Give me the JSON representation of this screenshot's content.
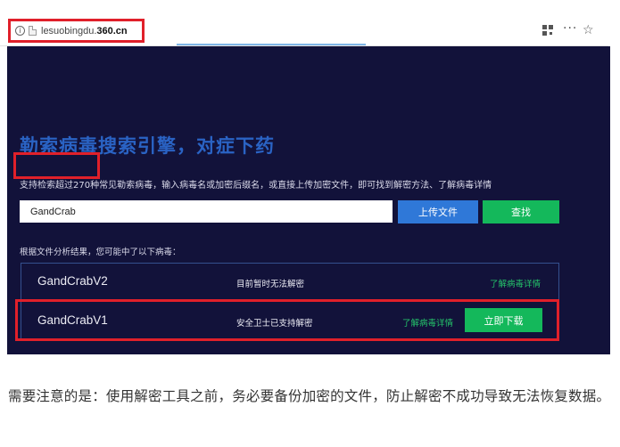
{
  "browser": {
    "url_prefix": "lesuobingdu.",
    "url_domain": "360.cn",
    "icons": {
      "info": "info-icon",
      "page": "page-icon",
      "qr": "qr-code-icon",
      "menu": "more-menu-icon",
      "bookmark": "star-icon"
    }
  },
  "page": {
    "headline": "勒索病毒搜索引擎，对症下药",
    "subtitle": "支持检索超过270种常见勒索病毒，输入病毒名或加密后缀名，或直接上传加密文件，即可找到解密方法、了解病毒详情",
    "search_value": "GandCrab",
    "upload_label": "上传文件",
    "search_label": "查找",
    "result_hint": "根据文件分析结果，您可能中了以下病毒：",
    "results": [
      {
        "name": "GandCrabV2",
        "status": "目前暂时无法解密",
        "details_label": "了解病毒详情"
      },
      {
        "name": "GandCrabV1",
        "status": "安全卫士已支持解密",
        "details_label": "了解病毒详情",
        "download_label": "立即下载"
      }
    ]
  },
  "note": "需要注意的是：使用解密工具之前，务必要备份加密的文件，防止解密不成功导致无法恢复数据。",
  "colors": {
    "panel_bg": "#12123a",
    "headline": "#2a63c4",
    "upload_button": "#2f78d8",
    "green_button": "#14b85b",
    "link": "#24c46a",
    "highlight": "#e0202a"
  }
}
